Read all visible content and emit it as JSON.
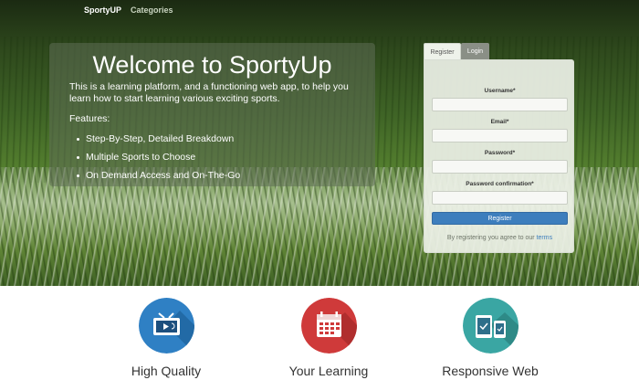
{
  "nav": {
    "brand": "SportyUP",
    "categories": "Categories"
  },
  "welcome": {
    "heading": "Welcome to SportyUp",
    "intro": "This is a learning platform, and a functioning web app, to help you learn how to start learning various exciting sports.",
    "features_title": "Features:",
    "features": [
      "Step-By-Step, Detailed Breakdown",
      "Multiple Sports to Choose",
      "On Demand Access and On-The-Go"
    ]
  },
  "auth": {
    "tabs": [
      "Register",
      "Login"
    ],
    "username_label": "Username*",
    "email_label": "Email*",
    "password_label": "Password*",
    "password_confirm_label": "Password confirmation*",
    "register_button": "Register",
    "terms_text": "By registering you agree to our",
    "terms_link": "terms"
  },
  "features_section": [
    {
      "title": "High Quality",
      "icon": "tv-icon",
      "color": "#2f80c4"
    },
    {
      "title": "Your Learning",
      "icon": "calendar-icon",
      "color": "#cf3a3a"
    },
    {
      "title": "Responsive Web",
      "icon": "devices-icon",
      "color": "#3aa6a3"
    }
  ],
  "colors": {
    "primary": "#3d7ebd"
  }
}
